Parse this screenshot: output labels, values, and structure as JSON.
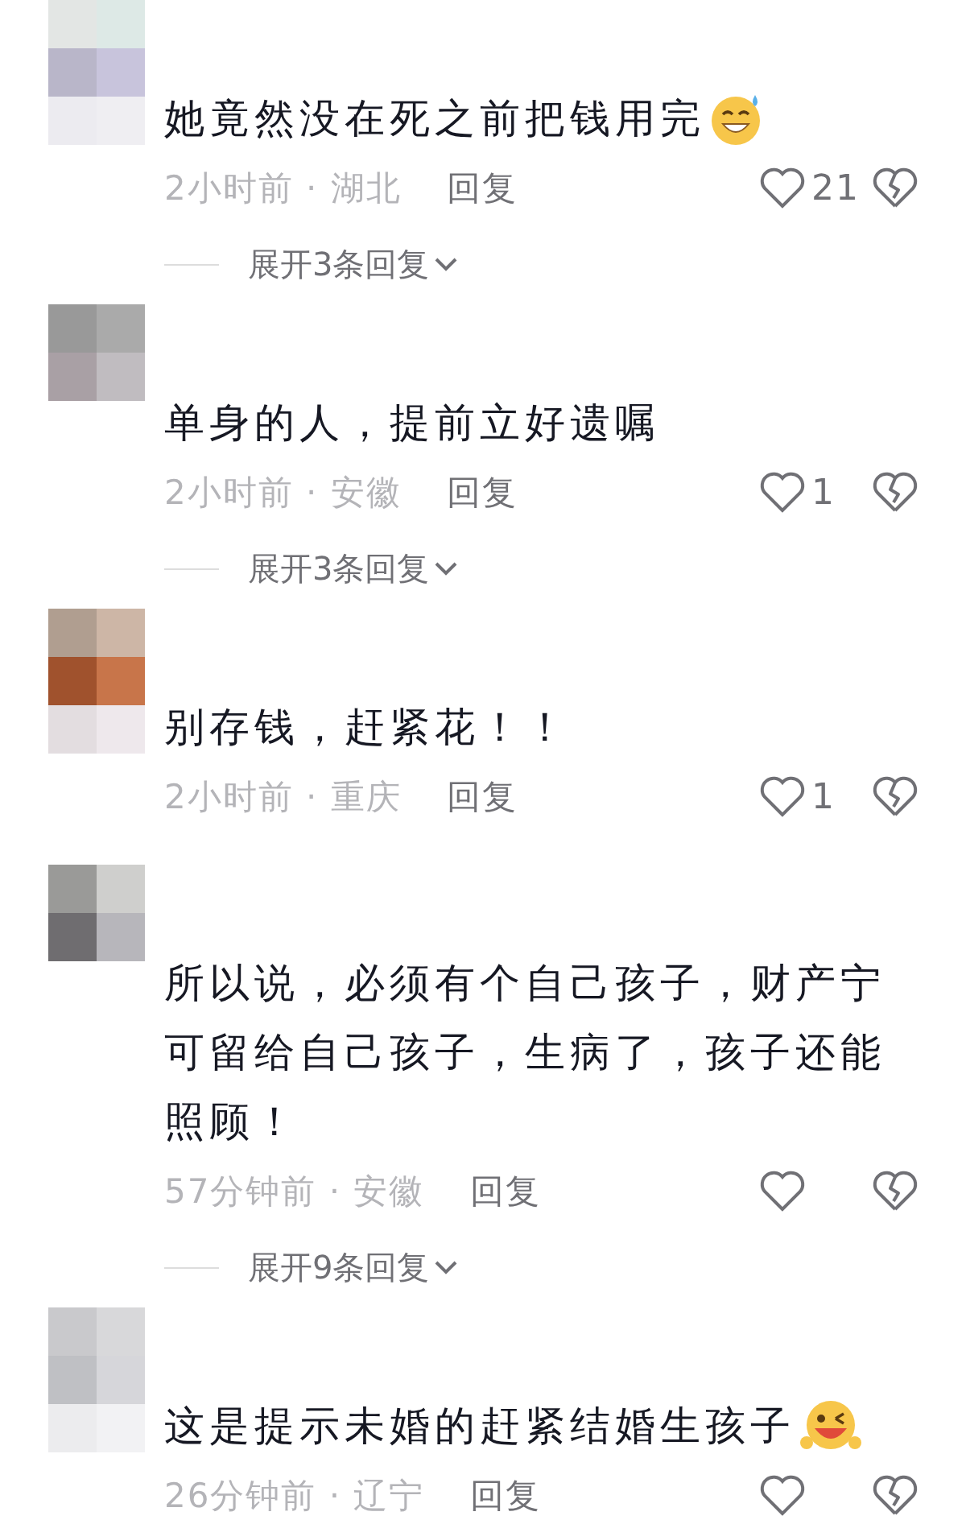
{
  "comments": [
    {
      "text": "她竟然没在死之前把钱用完",
      "emoji": {
        "kind": "grin-sweat"
      },
      "time": "2小时前 · 湖北",
      "reply": "回复",
      "likes": "21",
      "expand": "展开3条回复"
    },
    {
      "text": "单身的人，提前立好遗嘱",
      "time": "2小时前 · 安徽",
      "reply": "回复",
      "likes": "1",
      "expand": "展开3条回复"
    },
    {
      "text": "别存钱，赶紧花！！",
      "time": "2小时前 · 重庆",
      "reply": "回复",
      "likes": "1"
    },
    {
      "text": "所以说，必须有个自己孩子，财产宁可留给自己孩子，生病了，孩子还能照顾！",
      "time": "57分钟前 · 安徽",
      "reply": "回复",
      "expand": "展开9条回复"
    },
    {
      "text": "这是提示未婚的赶紧结婚生孩子",
      "emoji": {
        "kind": "wink"
      },
      "time": "26分钟前 · 辽宁",
      "reply": "回复"
    }
  ]
}
